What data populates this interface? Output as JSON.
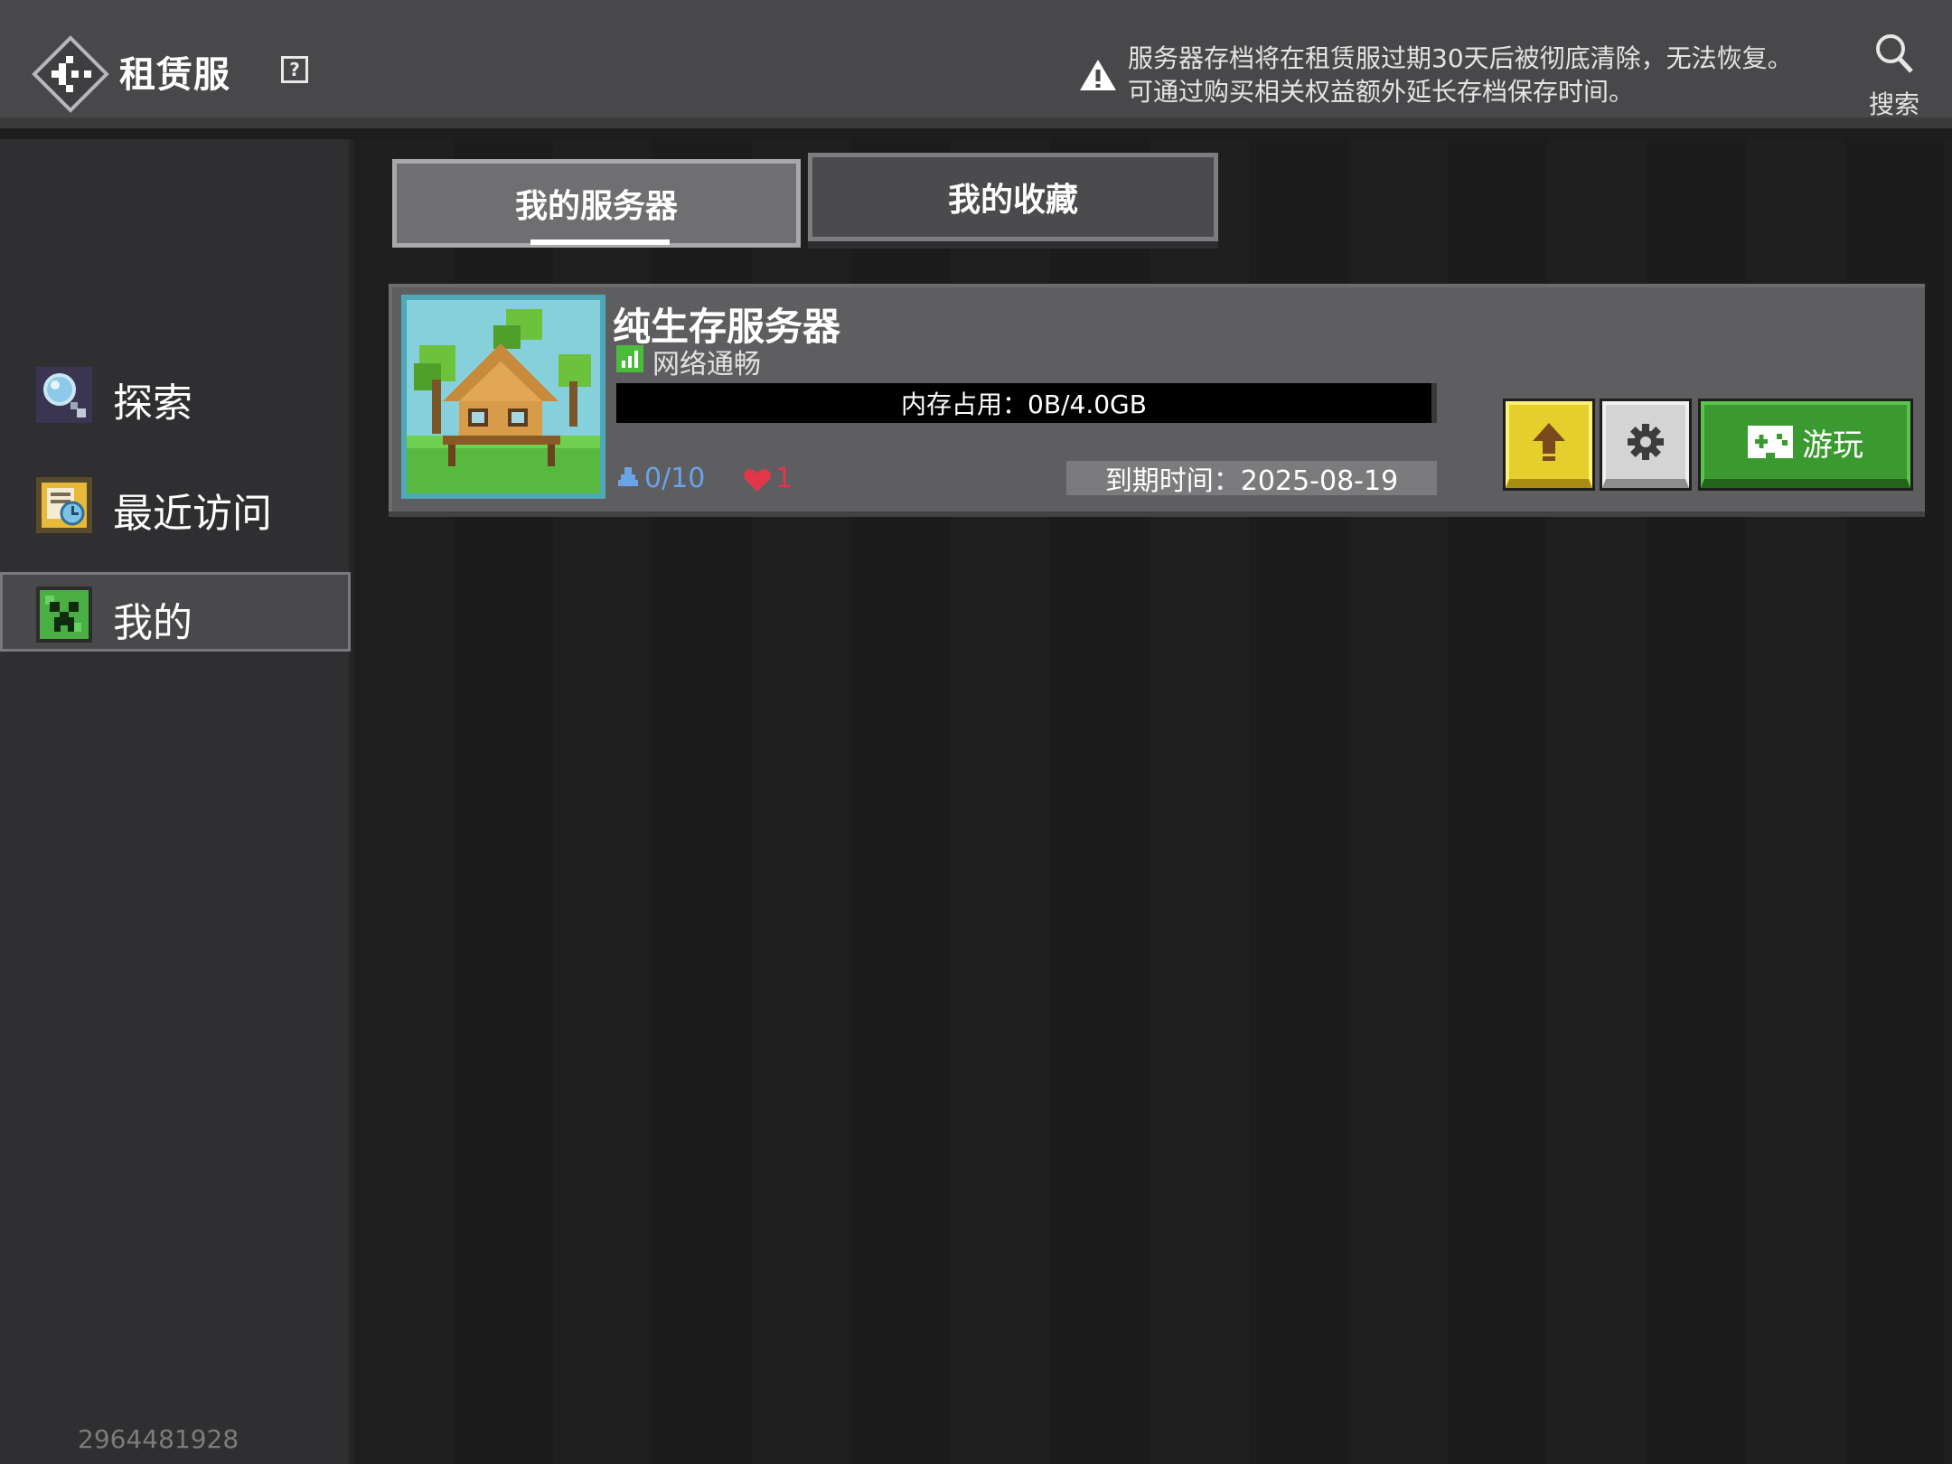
{
  "header": {
    "title": "租赁服",
    "help_glyph": "?",
    "notice_line1": "服务器存档将在租赁服过期30天后被彻底清除，无法恢复。",
    "notice_line2": "可通过购买相关权益额外延长存档保存时间。",
    "search_label": "搜索",
    "icons": [
      "back-icon",
      "help-icon",
      "warning-icon",
      "search-icon"
    ]
  },
  "sidebar": {
    "items": [
      {
        "label": "探索",
        "icon": "explore-magnifier-icon",
        "active": false
      },
      {
        "label": "最近访问",
        "icon": "recent-visit-icon",
        "active": false
      },
      {
        "label": "我的",
        "icon": "creeper-face-icon",
        "active": true
      }
    ],
    "user_id": "2964481928"
  },
  "tabs": [
    {
      "label": "我的服务器",
      "active": true
    },
    {
      "label": "我的收藏",
      "active": false
    }
  ],
  "server": {
    "name": "纯生存服务器",
    "network_status": "网络通畅",
    "memory_label": "内存占用：0B/4.0GB",
    "memory_usage": 0,
    "players": "0/10",
    "likes": "1",
    "expire": "到期时间：2025-08-19",
    "play_label": "游玩",
    "colors": {
      "players": "#6aa3e6",
      "likes": "#e0384a",
      "upgrade": "#e4cf2d",
      "play": "#3b9a2f",
      "signal": "#4cbb3c"
    }
  }
}
